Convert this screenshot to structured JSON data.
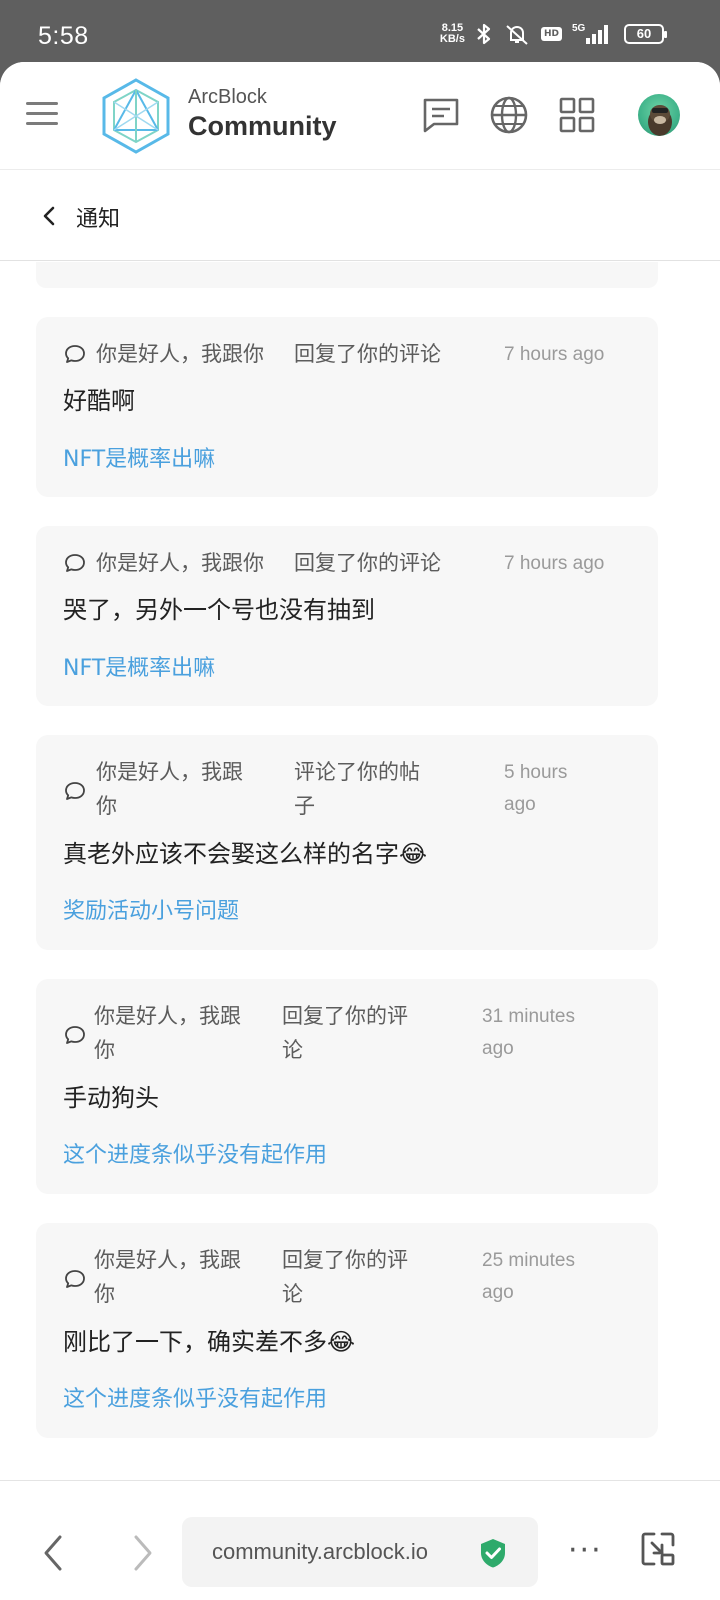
{
  "status": {
    "time": "5:58",
    "speed_top": "8.15",
    "speed_bottom": "KB/s",
    "hd": "HD",
    "network": "5G",
    "battery": "60"
  },
  "header": {
    "brand_top": "ArcBlock",
    "brand_bottom": "Community"
  },
  "subheader": {
    "title": "通知"
  },
  "notifications": [
    {
      "user": "你是好人，我跟你",
      "action": "回复了你的评论",
      "time": "7 hours ago",
      "content": "好酷啊",
      "topic": "NFT是概率出嘛"
    },
    {
      "user": "你是好人，我跟你",
      "action": "回复了你的评论",
      "time": "7 hours ago",
      "content": "哭了，另外一个号也没有抽到",
      "topic": "NFT是概率出嘛"
    },
    {
      "user_line1": "你是好人，我跟",
      "user_line2": "你",
      "action_line1": "评论了你的帖",
      "action_line2": "子",
      "time_line1": "5 hours",
      "time_line2": "ago",
      "content": "真老外应该不会娶这么样的名字😂",
      "topic": "奖励活动小号问题"
    },
    {
      "user_line1": "你是好人，我跟",
      "user_line2": "你",
      "action_line1": "回复了你的评",
      "action_line2": "论",
      "time_line1": "31 minutes",
      "time_line2": "ago",
      "content": "手动狗头",
      "topic": "这个进度条似乎没有起作用"
    },
    {
      "user_line1": "你是好人，我跟",
      "user_line2": "你",
      "action_line1": "回复了你的评",
      "action_line2": "论",
      "time_line1": "25 minutes",
      "time_line2": "ago",
      "content": "刚比了一下，确实差不多😂",
      "topic": "这个进度条似乎没有起作用"
    }
  ],
  "browser": {
    "url": "community.arcblock.io",
    "more": "···"
  },
  "colors": {
    "link": "#4aa0de",
    "card_bg": "#f7f7f7",
    "secure": "#2eaa6b"
  }
}
